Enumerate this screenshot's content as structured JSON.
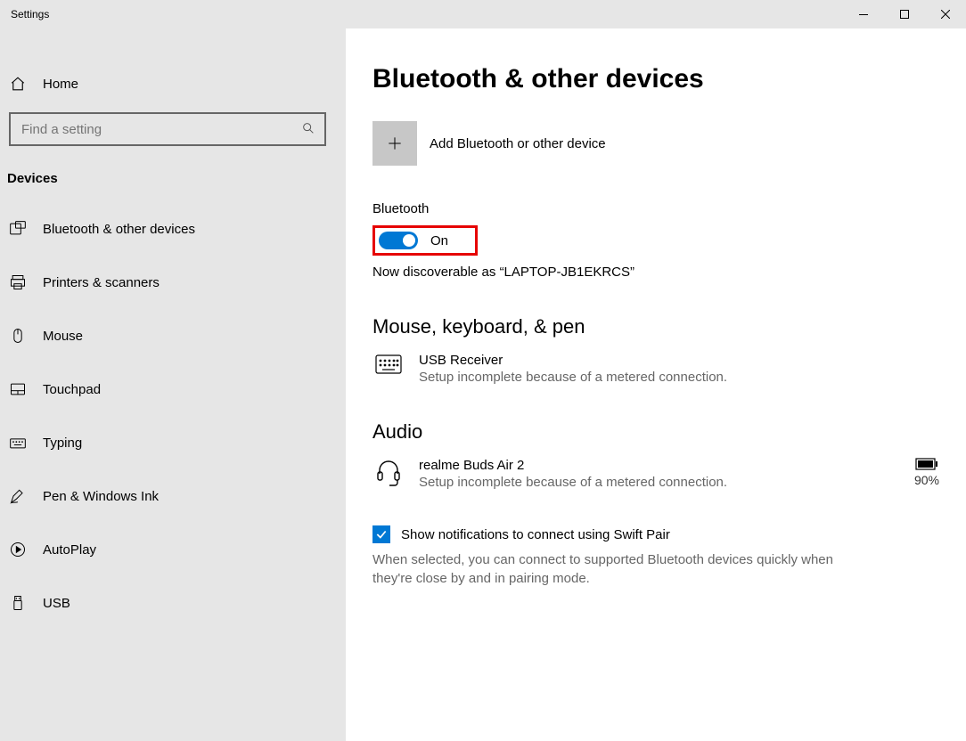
{
  "window": {
    "title": "Settings"
  },
  "sidebar": {
    "home": "Home",
    "search_placeholder": "Find a setting",
    "section": "Devices",
    "items": [
      {
        "icon": "bluetooth",
        "label": "Bluetooth & other devices"
      },
      {
        "icon": "printer",
        "label": "Printers & scanners"
      },
      {
        "icon": "mouse",
        "label": "Mouse"
      },
      {
        "icon": "touchpad",
        "label": "Touchpad"
      },
      {
        "icon": "typing",
        "label": "Typing"
      },
      {
        "icon": "pen",
        "label": "Pen & Windows Ink"
      },
      {
        "icon": "autoplay",
        "label": "AutoPlay"
      },
      {
        "icon": "usb",
        "label": "USB"
      }
    ]
  },
  "main": {
    "title": "Bluetooth & other devices",
    "add_label": "Add Bluetooth or other device",
    "bluetooth_label": "Bluetooth",
    "toggle_state": "On",
    "discoverable": "Now discoverable as “LAPTOP-JB1EKRCS”",
    "sections": {
      "mouse": {
        "title": "Mouse, keyboard, & pen",
        "device": {
          "name": "USB Receiver",
          "sub": "Setup incomplete because of a metered connection."
        }
      },
      "audio": {
        "title": "Audio",
        "device": {
          "name": "realme Buds Air 2",
          "sub": "Setup incomplete because of a metered connection.",
          "battery": "90%"
        }
      }
    },
    "swift": {
      "label": "Show notifications to connect using Swift Pair",
      "desc": "When selected, you can connect to supported Bluetooth devices quickly when they're close by and in pairing mode."
    }
  }
}
